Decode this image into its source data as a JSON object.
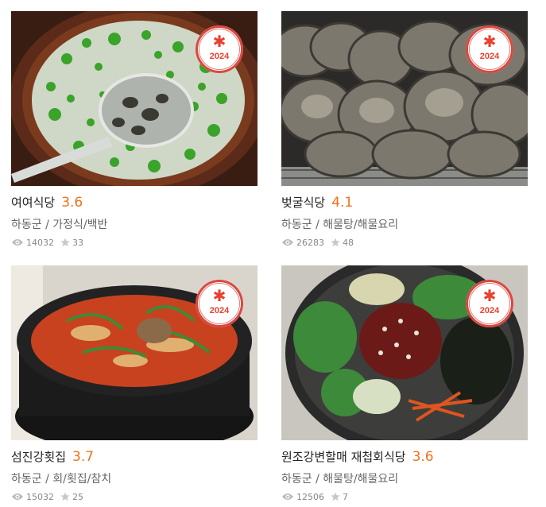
{
  "cards": [
    {
      "name": "여여식당",
      "rating": "3.6",
      "region": "하동군",
      "category": "가정식/백반",
      "views": "14032",
      "stars": "33",
      "badge_year": "2024",
      "photo": "재첩국"
    },
    {
      "name": "벚굴식당",
      "rating": "4.1",
      "region": "하동군",
      "category": "해물탕/해물요리",
      "views": "26283",
      "stars": "48",
      "badge_year": "2024",
      "photo": "벚굴구이"
    },
    {
      "name": "섬진강횟집",
      "rating": "3.7",
      "region": "하동군",
      "category": "회/횟집/참치",
      "views": "15032",
      "stars": "25",
      "badge_year": "2024",
      "photo": "매운탕"
    },
    {
      "name": "원조강변할매 재첩회식당",
      "rating": "3.6",
      "region": "하동군",
      "category": "해물탕/해물요리",
      "views": "12506",
      "stars": "7",
      "badge_year": "2024",
      "photo": "재첩회비빔밥"
    }
  ],
  "sep": "/",
  "colors": {
    "rating": "#f2711c",
    "badge": "#e8402f"
  },
  "icons": {
    "views": "eye-icon",
    "stars": "star-icon",
    "badge": "asterisk-icon"
  }
}
